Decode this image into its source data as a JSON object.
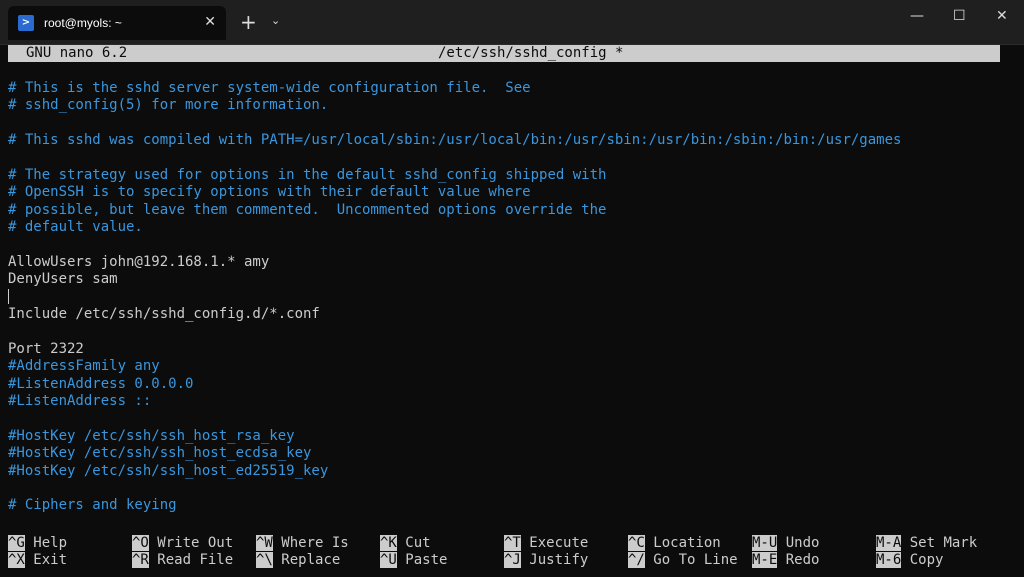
{
  "window": {
    "tab_title": "root@myols: ~",
    "tab_close": "✕",
    "new_tab": "+",
    "dropdown": "⌄",
    "minimize": "—",
    "maximize": "☐",
    "close": "✕"
  },
  "nano": {
    "version": "GNU nano 6.2",
    "filename": "/etc/ssh/sshd_config *"
  },
  "editor": {
    "lines": [
      {
        "text": "# This is the sshd server system-wide configuration file.  See",
        "type": "comment"
      },
      {
        "text": "# sshd_config(5) for more information.",
        "type": "comment"
      },
      {
        "text": "",
        "type": "plain"
      },
      {
        "text": "# This sshd was compiled with PATH=/usr/local/sbin:/usr/local/bin:/usr/sbin:/usr/bin:/sbin:/bin:/usr/games",
        "type": "comment"
      },
      {
        "text": "",
        "type": "plain"
      },
      {
        "text": "# The strategy used for options in the default sshd_config shipped with",
        "type": "comment"
      },
      {
        "text": "# OpenSSH is to specify options with their default value where",
        "type": "comment"
      },
      {
        "text": "# possible, but leave them commented.  Uncommented options override the",
        "type": "comment"
      },
      {
        "text": "# default value.",
        "type": "comment"
      },
      {
        "text": "",
        "type": "plain"
      },
      {
        "text": "AllowUsers john@192.168.1.* amy",
        "type": "plain"
      },
      {
        "text": "DenyUsers sam",
        "type": "plain"
      },
      {
        "text": "",
        "type": "cursor"
      },
      {
        "text": "Include /etc/ssh/sshd_config.d/*.conf",
        "type": "plain"
      },
      {
        "text": "",
        "type": "plain"
      },
      {
        "text": "Port 2322",
        "type": "plain"
      },
      {
        "text": "#AddressFamily any",
        "type": "comment"
      },
      {
        "text": "#ListenAddress 0.0.0.0",
        "type": "comment"
      },
      {
        "text": "#ListenAddress ::",
        "type": "comment"
      },
      {
        "text": "",
        "type": "plain"
      },
      {
        "text": "#HostKey /etc/ssh/ssh_host_rsa_key",
        "type": "comment"
      },
      {
        "text": "#HostKey /etc/ssh/ssh_host_ecdsa_key",
        "type": "comment"
      },
      {
        "text": "#HostKey /etc/ssh/ssh_host_ed25519_key",
        "type": "comment"
      },
      {
        "text": "",
        "type": "plain"
      },
      {
        "text": "# Ciphers and keying",
        "type": "comment"
      }
    ]
  },
  "shortcuts": [
    {
      "key": "^G",
      "label": "Help"
    },
    {
      "key": "^X",
      "label": "Exit"
    },
    {
      "key": "^O",
      "label": "Write Out"
    },
    {
      "key": "^R",
      "label": "Read File"
    },
    {
      "key": "^W",
      "label": "Where Is"
    },
    {
      "key": "^\\",
      "label": "Replace"
    },
    {
      "key": "^K",
      "label": "Cut"
    },
    {
      "key": "^U",
      "label": "Paste"
    },
    {
      "key": "^T",
      "label": "Execute"
    },
    {
      "key": "^J",
      "label": "Justify"
    },
    {
      "key": "^C",
      "label": "Location"
    },
    {
      "key": "^/",
      "label": "Go To Line"
    },
    {
      "key": "M-U",
      "label": "Undo"
    },
    {
      "key": "M-E",
      "label": "Redo"
    },
    {
      "key": "M-A",
      "label": "Set Mark"
    },
    {
      "key": "M-6",
      "label": "Copy"
    }
  ],
  "colors": {
    "background": "#0c0c0c",
    "comment": "#3a96dd",
    "text": "#cccccc"
  }
}
